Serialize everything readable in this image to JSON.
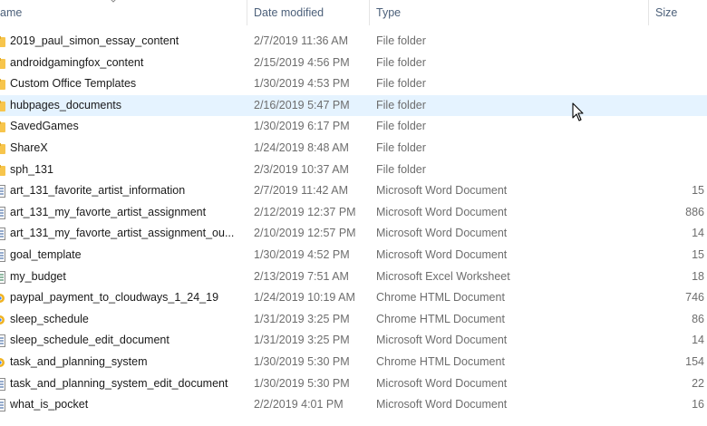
{
  "columns": {
    "name": "ame",
    "date": "Date modified",
    "type": "Type",
    "size": "Size"
  },
  "files": [
    {
      "name": "2019_paul_simon_essay_content",
      "date": "2/7/2019 11:36 AM",
      "type": "File folder",
      "size": "",
      "icon": "folder-icon"
    },
    {
      "name": "androidgamingfox_content",
      "date": "2/15/2019 4:56 PM",
      "type": "File folder",
      "size": "",
      "icon": "folder-icon"
    },
    {
      "name": "Custom Office Templates",
      "date": "1/30/2019 4:53 PM",
      "type": "File folder",
      "size": "",
      "icon": "folder-icon"
    },
    {
      "name": "hubpages_documents",
      "date": "2/16/2019 5:47 PM",
      "type": "File folder",
      "size": "",
      "icon": "folder-icon"
    },
    {
      "name": "SavedGames",
      "date": "1/30/2019 6:17 PM",
      "type": "File folder",
      "size": "",
      "icon": "folder-icon"
    },
    {
      "name": "ShareX",
      "date": "1/24/2019 8:48 AM",
      "type": "File folder",
      "size": "",
      "icon": "folder-icon"
    },
    {
      "name": "sph_131",
      "date": "2/3/2019 10:37 AM",
      "type": "File folder",
      "size": "",
      "icon": "folder-icon"
    },
    {
      "name": "art_131_favorite_artist_information",
      "date": "2/7/2019 11:42 AM",
      "type": "Microsoft Word Document",
      "size": "15",
      "icon": "word-document-icon"
    },
    {
      "name": "art_131_my_favorte_artist_assignment",
      "date": "2/12/2019 12:37 PM",
      "type": "Microsoft Word Document",
      "size": "886",
      "icon": "word-document-icon"
    },
    {
      "name": "art_131_my_favorte_artist_assignment_ou...",
      "date": "2/10/2019 12:57 PM",
      "type": "Microsoft Word Document",
      "size": "14",
      "icon": "word-document-icon"
    },
    {
      "name": "goal_template",
      "date": "1/30/2019 4:52 PM",
      "type": "Microsoft Word Document",
      "size": "15",
      "icon": "word-document-icon"
    },
    {
      "name": "my_budget",
      "date": "2/13/2019 7:51 AM",
      "type": "Microsoft Excel Worksheet",
      "size": "18",
      "icon": "excel-worksheet-icon"
    },
    {
      "name": "paypal_payment_to_cloudways_1_24_19",
      "date": "1/24/2019 10:19 AM",
      "type": "Chrome HTML Document",
      "size": "746",
      "icon": "chrome-html-icon"
    },
    {
      "name": "sleep_schedule",
      "date": "1/31/2019 3:25 PM",
      "type": "Chrome HTML Document",
      "size": "86",
      "icon": "chrome-html-icon"
    },
    {
      "name": "sleep_schedule_edit_document",
      "date": "1/31/2019 3:25 PM",
      "type": "Microsoft Word Document",
      "size": "14",
      "icon": "word-document-icon"
    },
    {
      "name": "task_and_planning_system",
      "date": "1/30/2019 5:30 PM",
      "type": "Chrome HTML Document",
      "size": "154",
      "icon": "chrome-html-icon"
    },
    {
      "name": "task_and_planning_system_edit_document",
      "date": "1/30/2019 5:30 PM",
      "type": "Microsoft Word Document",
      "size": "22",
      "icon": "word-document-icon"
    },
    {
      "name": "what_is_pocket",
      "date": "2/2/2019 4:01 PM",
      "type": "Microsoft Word Document",
      "size": "16",
      "icon": "word-document-icon"
    }
  ],
  "hovered_row": 3,
  "colors": {
    "hover_background": "#e5f3ff",
    "header_text": "#4c607a",
    "folder": "#f7c54c",
    "chrome": "#f0b323"
  }
}
